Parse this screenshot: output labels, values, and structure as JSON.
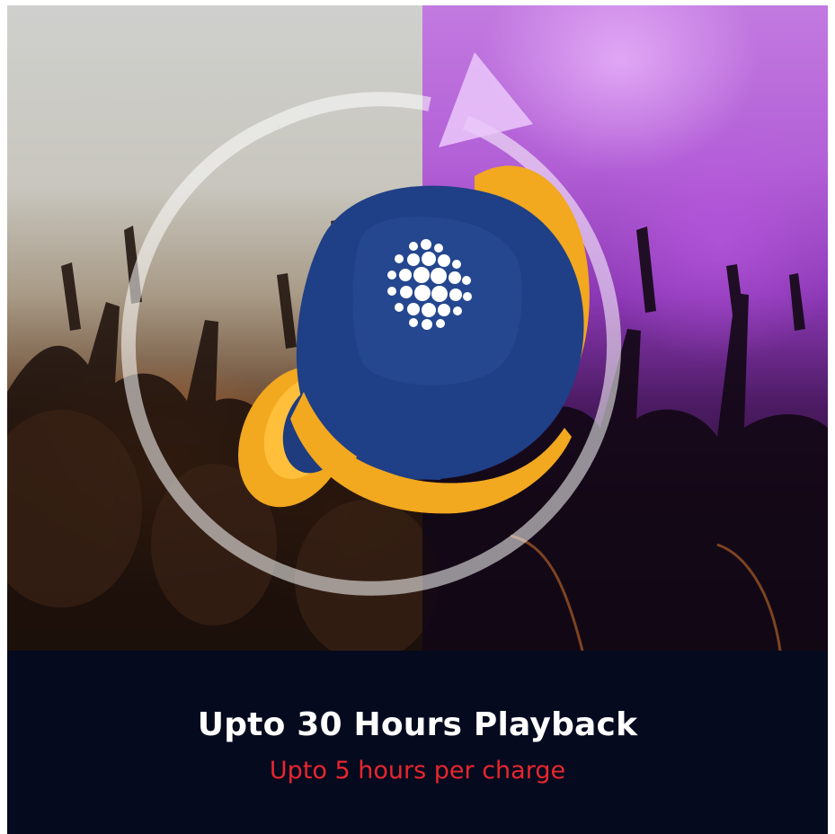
{
  "caption": {
    "headline": "Upto 30 Hours Playback",
    "subline": "Upto 5 hours per charge"
  },
  "colors": {
    "headline": "#ffffff",
    "subline": "#e8262d",
    "caption_background": "#050a1e",
    "earbud_shell": "#1f3f86",
    "earbud_wing": "#f2a81f"
  },
  "icons": {
    "earbud_logo": "dot-sphere-logo",
    "ring": "circular-arrow"
  }
}
